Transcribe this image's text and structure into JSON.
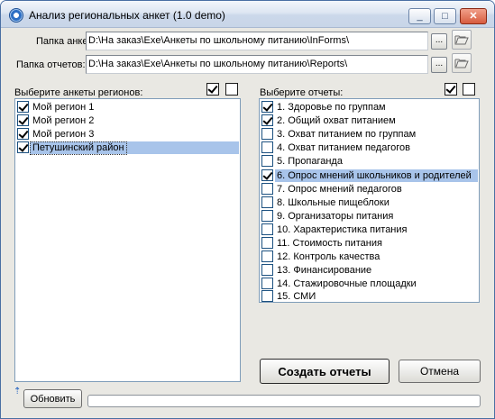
{
  "window": {
    "title": "Анализ региональных анкет (1.0 demo)",
    "buttons": {
      "minimize": "_",
      "maximize": "□",
      "close": "✕"
    }
  },
  "paths": {
    "ankety_label": "Папка анкет:",
    "ankety_value": "D:\\На заказ\\Exe\\Анкеты по школьному питанию\\InForms\\",
    "reports_label": "Папка отчетов:",
    "reports_value": "D:\\На заказ\\Exe\\Анкеты по школьному питанию\\Reports\\",
    "browse_label": "..."
  },
  "regions": {
    "header": "Выберите анкеты регионов:",
    "select_all_checked": true,
    "clear_all_checked": false,
    "items": [
      {
        "label": "Мой регион 1",
        "checked": true
      },
      {
        "label": "Мой регион 2",
        "checked": true
      },
      {
        "label": "Мой регион 3",
        "checked": true
      },
      {
        "label": "Петушинский район",
        "checked": true
      }
    ]
  },
  "reports": {
    "header": "Выберите отчеты:",
    "select_all_checked": true,
    "clear_all_checked": false,
    "items": [
      {
        "label": "1. Здоровье по группам",
        "checked": true
      },
      {
        "label": "2. Общий охват питанием",
        "checked": true
      },
      {
        "label": "3. Охват питанием по группам",
        "checked": false
      },
      {
        "label": "4. Охват питанием педагогов",
        "checked": false
      },
      {
        "label": "5. Пропаганда",
        "checked": false
      },
      {
        "label": "6. Опрос мнений школьников и родителей",
        "checked": true
      },
      {
        "label": "7. Опрос мнений педагогов",
        "checked": false
      },
      {
        "label": "8. Школьные пищеблоки",
        "checked": false
      },
      {
        "label": "9. Организаторы питания",
        "checked": false
      },
      {
        "label": "10. Характеристика питания",
        "checked": false
      },
      {
        "label": "11. Стоимость питания",
        "checked": false
      },
      {
        "label": "12. Контроль качества",
        "checked": false
      },
      {
        "label": "13. Финансирование",
        "checked": false
      },
      {
        "label": "14. Стажировочные площадки",
        "checked": false
      },
      {
        "label": "15. СМИ",
        "checked": false
      }
    ]
  },
  "actions": {
    "create": "Создать отчеты",
    "cancel": "Отмена",
    "refresh": "Обновить"
  },
  "progress": {
    "value": 0
  },
  "colors": {
    "selection": "#a8c4ea",
    "check": "#21a121"
  }
}
